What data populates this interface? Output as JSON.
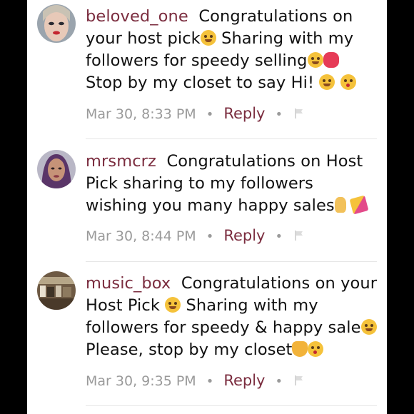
{
  "comments": [
    {
      "username": "beloved_one",
      "text_parts": [
        "Congratulations on your host pick",
        " Sharing with my followers for speedy selling",
        "",
        " Stop by my closet to say Hi! ",
        ""
      ],
      "timestamp": "Mar 30, 8:33 PM",
      "reply_label": "Reply",
      "emojis": [
        "smiling-hearts-face",
        "hugging-face",
        "hibiscus",
        "hugging-face",
        "kissing-face"
      ]
    },
    {
      "username": "mrsmcrz",
      "text_parts": [
        "Congratulations on Host Pick sharing to my followers wishing you many happy sales"
      ],
      "timestamp": "Mar 30, 8:44 PM",
      "reply_label": "Reply",
      "emojis": [
        "crossed-fingers",
        "party-popper"
      ]
    },
    {
      "username": "music_box",
      "text_parts": [
        "Congratulations on your Host Pick ",
        " Sharing with my followers for speedy & happy sale",
        " Please, stop by my closet",
        ""
      ],
      "timestamp": "Mar 30, 9:35 PM",
      "reply_label": "Reply",
      "emojis": [
        "hugging-face",
        "hugging-face",
        "folded-hands",
        "kissing-face"
      ]
    }
  ],
  "colors": {
    "username": "#7b2d3f",
    "meta": "#9a9a9a",
    "background": "#000000",
    "panel": "#ffffff"
  }
}
